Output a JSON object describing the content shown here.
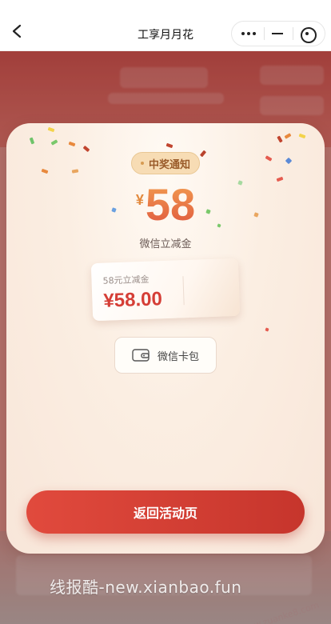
{
  "header": {
    "title": "工享月月花",
    "icons": [
      "back-chevron-icon",
      "more-dots-icon",
      "minimize-icon",
      "close-target-icon"
    ]
  },
  "modal": {
    "badge_label": "中奖通知",
    "currency_symbol": "¥",
    "amount": "58",
    "amount_caption": "微信立减金",
    "coupon": {
      "name": "58元立减金",
      "value": "¥58.00"
    },
    "wallet_button_label": "微信卡包",
    "return_button_label": "返回活动页"
  },
  "watermark": {
    "text": "线报酷-new.xianbao.fun"
  },
  "colors": {
    "accent_red": "#d53e36",
    "button_red": "#e14a3d",
    "badge_bg": "#f7dcb4",
    "amount_orange": "#f29b4f"
  }
}
